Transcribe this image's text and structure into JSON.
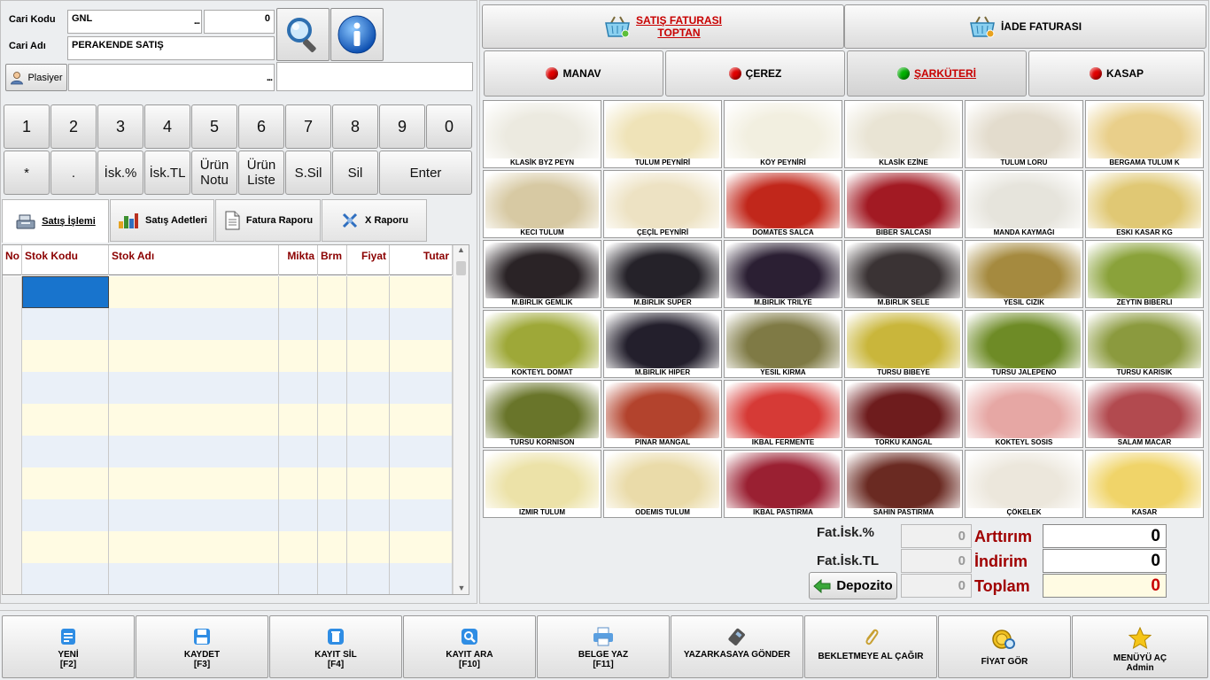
{
  "form": {
    "cari_kodu_label": "Cari Kodu",
    "cari_kodu_value": "GNL",
    "cari_kodu_num": "0",
    "cari_adi_label": "Cari Adı",
    "cari_adi_value": "PERAKENDE SATIŞ",
    "plasiyer_label": "Plasiyer",
    "plasiyer_value": "",
    "dots": "..."
  },
  "keypad": {
    "row1": [
      "1",
      "2",
      "3",
      "4",
      "5",
      "6",
      "7",
      "8",
      "9",
      "0"
    ],
    "row2": [
      "*",
      ".",
      "İsk.%",
      "İsk.TL",
      "Ürün\nNotu",
      "Ürün\nListe",
      "S.Sil",
      "Sil",
      "Enter"
    ]
  },
  "tabs": [
    {
      "label": "Satış İşlemi",
      "icon": "cash-register-icon"
    },
    {
      "label": "Satış Adetleri",
      "icon": "bar-chart-icon"
    },
    {
      "label": "Fatura Raporu",
      "icon": "document-icon"
    },
    {
      "label": "X Raporu",
      "icon": "report-icon"
    }
  ],
  "grid": {
    "columns": [
      "No",
      "Stok Kodu",
      "Stok Adı",
      "Mikta",
      "Brm",
      "Fiyat",
      "Tutar"
    ]
  },
  "top_buttons": {
    "satis_line1": "SATIŞ FATURASI",
    "satis_line2": "TOPTAN",
    "iade": "İADE FATURASI"
  },
  "categories": [
    {
      "label": "MANAV",
      "dot_color": "#e00000"
    },
    {
      "label": "ÇEREZ",
      "dot_color": "#e00000"
    },
    {
      "label": "ŞARKÜTERİ",
      "dot_color": "#00b000"
    },
    {
      "label": "KASAP",
      "dot_color": "#e00000"
    }
  ],
  "products": [
    {
      "name": "KLASİK BYZ PEYN",
      "color": "#eceae0"
    },
    {
      "name": "TULUM PEYNİRİ",
      "color": "#efe3b8"
    },
    {
      "name": "KÖY PEYNİRİ",
      "color": "#f2efe0"
    },
    {
      "name": "KLASİK EZİNE",
      "color": "#e9e4d4"
    },
    {
      "name": "TULUM LORU",
      "color": "#e3dccd"
    },
    {
      "name": "BERGAMA TULUM K",
      "color": "#e9cf8a"
    },
    {
      "name": "KECI TULUM",
      "color": "#d7c9a3"
    },
    {
      "name": "ÇEÇİL PEYNİRİ",
      "color": "#ede2c3"
    },
    {
      "name": "DOMATES  SALCA",
      "color": "#c1271b"
    },
    {
      "name": "BIBER SALCASI",
      "color": "#a21a23"
    },
    {
      "name": "MANDA KAYMAĞI",
      "color": "#e6e4dc"
    },
    {
      "name": "ESKI KASAR KG",
      "color": "#e0c874"
    },
    {
      "name": "M.BIRLIK GEMLIK",
      "color": "#2a2326"
    },
    {
      "name": "M.BIRLIK SUPER",
      "color": "#252229"
    },
    {
      "name": "M.BIRLIK TRILYE",
      "color": "#2b1f33"
    },
    {
      "name": "M.BIRLIK SELE",
      "color": "#3a3334"
    },
    {
      "name": "YESIL CIZIK",
      "color": "#a58a3f"
    },
    {
      "name": "ZEYTIN BIBERLI",
      "color": "#8aa23a"
    },
    {
      "name": "KOKTEYL DOMAT",
      "color": "#9ea838"
    },
    {
      "name": "M.BIRLIK HIPER",
      "color": "#231f2c"
    },
    {
      "name": "YESIL KIRMA",
      "color": "#7f7a45"
    },
    {
      "name": "TURSU BIBEYE",
      "color": "#c9b63b"
    },
    {
      "name": "TURSU JALEPENO",
      "color": "#6e8b26"
    },
    {
      "name": "TURSU KARISIK",
      "color": "#8b9a3e"
    },
    {
      "name": "TURSU KORNISON",
      "color": "#69752a"
    },
    {
      "name": "PINAR MANGAL",
      "color": "#b3432d"
    },
    {
      "name": "IKBAL FERMENTE",
      "color": "#d63a36"
    },
    {
      "name": "TORKU KANGAL",
      "color": "#6e1c1d"
    },
    {
      "name": "KOKTEYL SOSIS",
      "color": "#e6a7a4"
    },
    {
      "name": "SALAM MACAR",
      "color": "#b24a4f"
    },
    {
      "name": "IZMIR TULUM",
      "color": "#ece2a8"
    },
    {
      "name": "ODEMIS TULUM",
      "color": "#eadba9"
    },
    {
      "name": "IKBAL PASTIRMA",
      "color": "#9a2032"
    },
    {
      "name": "SAHIN PASTIRMA",
      "color": "#6a2a22"
    },
    {
      "name": "ÇÖKELEK",
      "color": "#ece7dc"
    },
    {
      "name": "KASAR",
      "color": "#f0d469"
    }
  ],
  "totals": {
    "fat_isk_pct_label": "Fat.İsk.%",
    "fat_isk_pct_value": "0",
    "fat_isk_tl_label": "Fat.İsk.TL",
    "fat_isk_tl_value": "0",
    "depozito_label": "Depozito",
    "depozito_value": "0",
    "arttirim_label": "Arttırım",
    "arttirim_value": "0",
    "indirim_label": "İndirim",
    "indirim_value": "0",
    "toplam_label": "Toplam",
    "toplam_value": "0"
  },
  "bottom": [
    {
      "line1": "YENİ",
      "line2": "[F2]"
    },
    {
      "line1": "KAYDET",
      "line2": "[F3]"
    },
    {
      "line1": "KAYIT SİL",
      "line2": "[F4]"
    },
    {
      "line1": "KAYIT ARA",
      "line2": "[F10]"
    },
    {
      "line1": "BELGE YAZ",
      "line2": "[F11]"
    },
    {
      "line1": "YAZARKASAYA GÖNDER",
      "line2": ""
    },
    {
      "line1": "BEKLETMEYE AL ÇAĞIR",
      "line2": ""
    },
    {
      "line1": "FİYAT GÖR",
      "line2": ""
    },
    {
      "line1": "MENÜYÜ AÇ",
      "line2": "Admin"
    }
  ],
  "colors": {
    "accent_red": "#a00000",
    "header_red": "#8b0000",
    "selected_cell": "#1874cd",
    "row_yellow": "#fffbe3",
    "row_blue": "#eaf0f8"
  }
}
